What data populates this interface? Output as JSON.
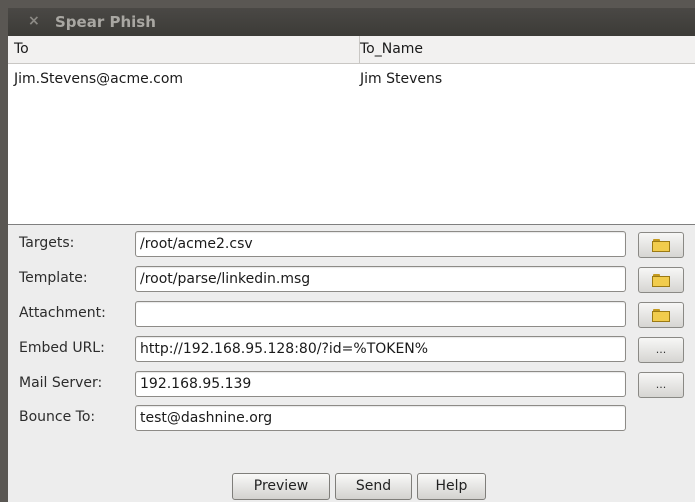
{
  "window": {
    "title": "Spear Phish",
    "close_glyph": "×"
  },
  "table": {
    "columns": [
      "To",
      "To_Name"
    ],
    "rows": [
      [
        "Jim.Stevens@acme.com",
        "Jim Stevens"
      ]
    ]
  },
  "form": {
    "targets": {
      "label": "Targets:",
      "value": "/root/acme2.csv",
      "button_icon": "folder-icon"
    },
    "template": {
      "label": "Template:",
      "value": "/root/parse/linkedin.msg",
      "button_icon": "folder-icon"
    },
    "attachment": {
      "label": "Attachment:",
      "value": "",
      "button_icon": "folder-icon"
    },
    "embed_url": {
      "label": "Embed URL:",
      "value": "http://192.168.95.128:80/?id=%TOKEN%",
      "button_label": "..."
    },
    "mail_server": {
      "label": "Mail Server:",
      "value": "192.168.95.139",
      "button_label": "..."
    },
    "bounce_to": {
      "label": "Bounce To:",
      "value": "test@dashnine.org"
    }
  },
  "actions": {
    "preview": "Preview",
    "send": "Send",
    "help": "Help"
  }
}
